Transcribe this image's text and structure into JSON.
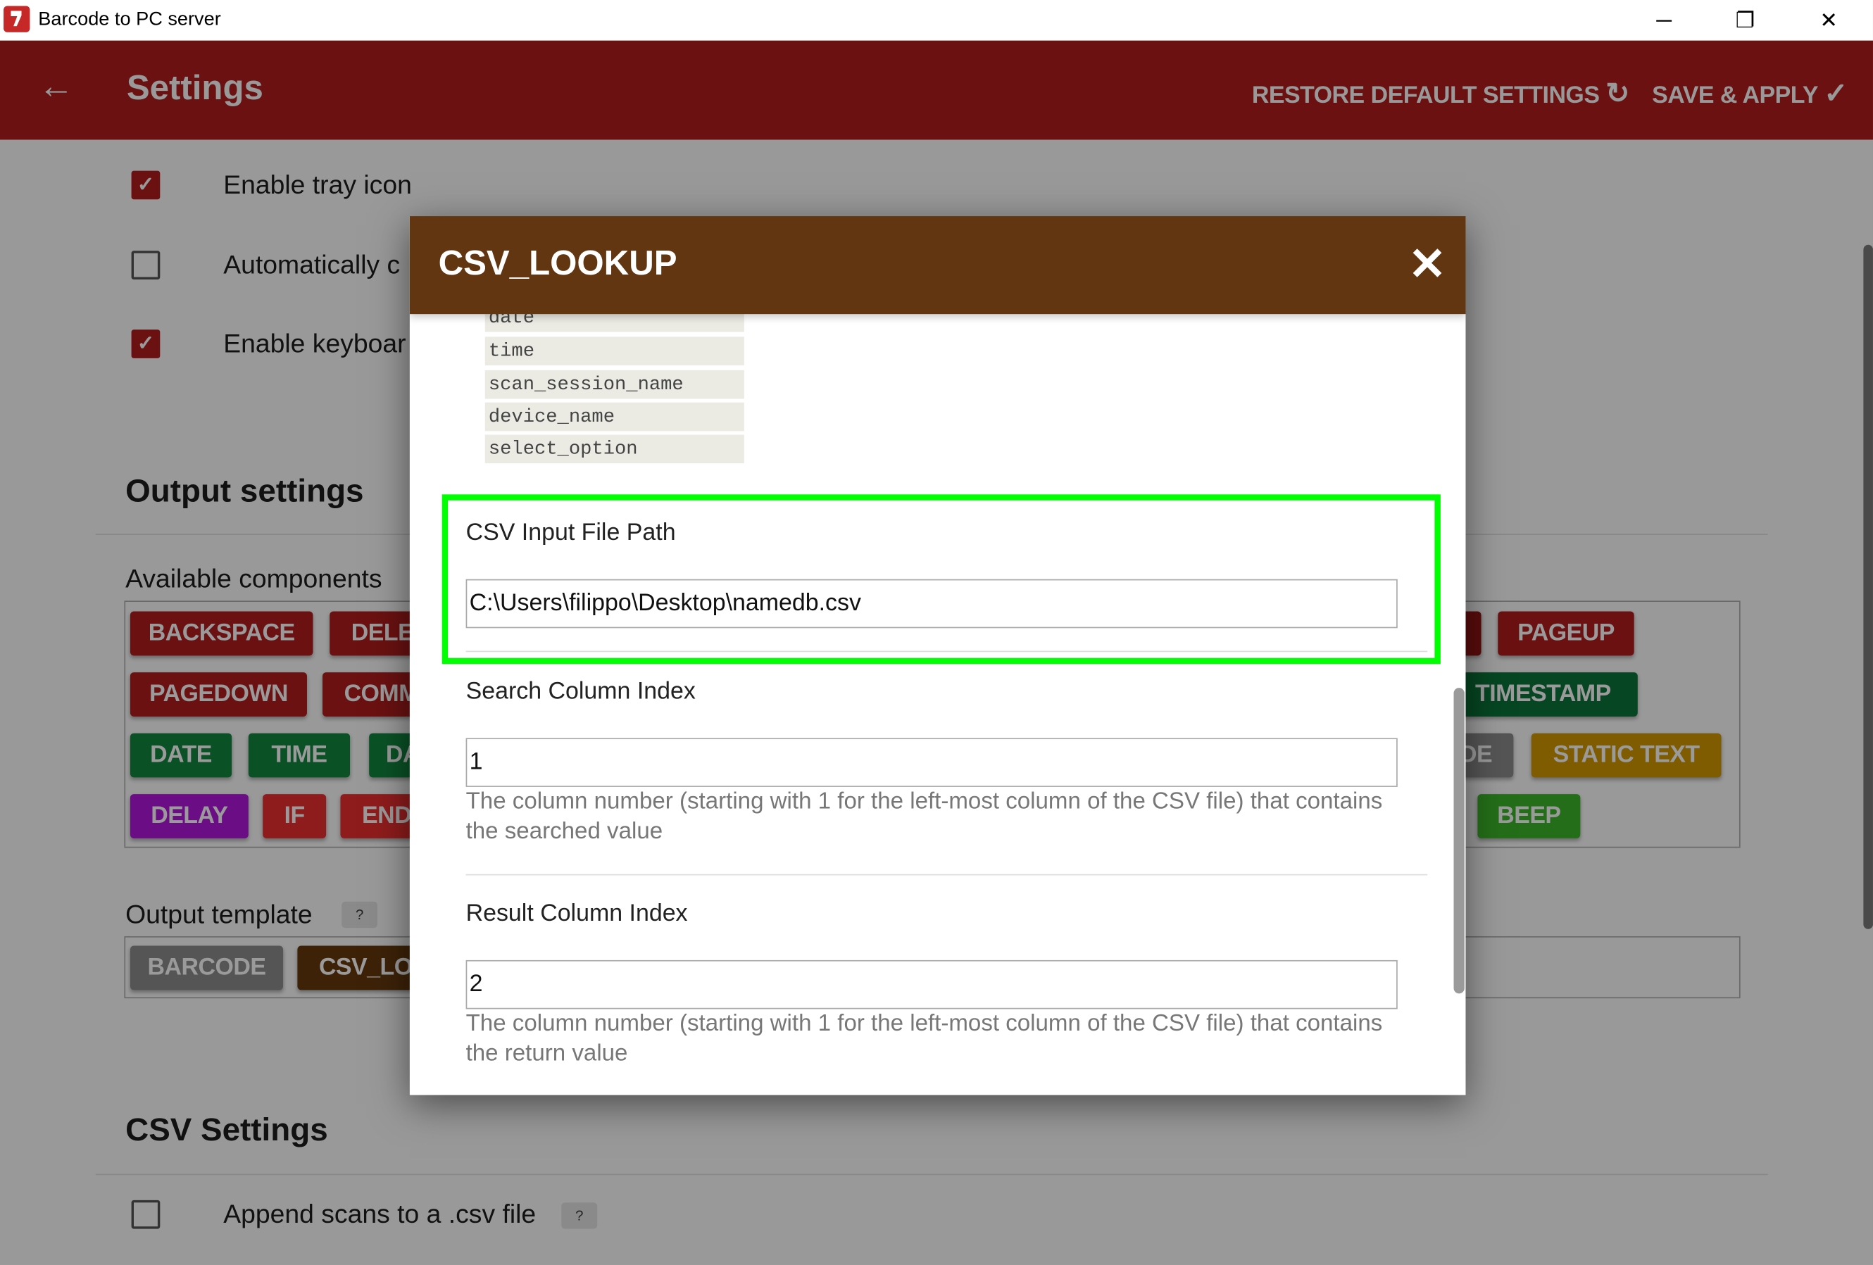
{
  "window": {
    "title": "Barcode to PC server",
    "controls": {
      "minimize": "─",
      "restore": "❐",
      "close": "✕"
    }
  },
  "header": {
    "title": "Settings",
    "back_icon": "←",
    "restore_label": "RESTORE DEFAULT SETTINGS",
    "restore_icon": "↻",
    "save_label": "SAVE & APPLY",
    "save_icon": "✓"
  },
  "general": [
    {
      "label": "Enable tray icon",
      "checked": true
    },
    {
      "label": "Automatically c",
      "checked": false
    },
    {
      "label": "Enable keyboar",
      "checked": true
    }
  ],
  "output": {
    "title": "Output settings",
    "available_label": "Available components",
    "chips": [
      {
        "label": "BACKSPACE",
        "color": "#6b1111"
      },
      {
        "label": "DELE",
        "color": "#6b1111"
      },
      {
        "label": "",
        "color": "#5a0c0c"
      },
      {
        "label": "PAGEUP",
        "color": "#6b1111"
      },
      {
        "label": "PAGEDOWN",
        "color": "#6b1111"
      },
      {
        "label": "COMM",
        "color": "#6b1111"
      },
      {
        "label": "TIMESTAMP",
        "color": "#064622"
      },
      {
        "label": "DATE",
        "color": "#0a5226"
      },
      {
        "label": "TIME",
        "color": "#0a5226"
      },
      {
        "label": "DA",
        "color": "#0a5226"
      },
      {
        "label": "DE",
        "color": "#555555"
      },
      {
        "label": "STATIC TEXT",
        "color": "#7f5c00"
      },
      {
        "label": "DELAY",
        "color": "#6b0d84"
      },
      {
        "label": "IF",
        "color": "#8f1c1c"
      },
      {
        "label": "END",
        "color": "#8f1c1c"
      },
      {
        "label": "BEEP",
        "color": "#246e19"
      }
    ],
    "template_label": "Output template",
    "help_badge": "?",
    "template_chips": [
      {
        "label": "BARCODE",
        "color": "#555555"
      },
      {
        "label": "CSV_LO",
        "color": "#3d2208"
      }
    ]
  },
  "csv": {
    "title": "CSV Settings",
    "append_label": "Append scans to a .csv file",
    "append_checked": false,
    "help_badge": "?"
  },
  "modal": {
    "title": "CSV_LOOKUP",
    "close_icon": "✕",
    "variables": [
      "date",
      "time",
      "scan_session_name",
      "device_name",
      "select_option"
    ],
    "fields": [
      {
        "label": "CSV Input File Path",
        "value": "C:\\Users\\filippo\\Desktop\\namedb.csv"
      },
      {
        "label": "Search Column Index",
        "value": "1",
        "help": "The column number (starting with 1 for the left-most column of the CSV file) that contains the searched value"
      },
      {
        "label": "Result Column Index",
        "value": "2",
        "help": "The column number (starting with 1 for the left-most column of the CSV file) that contains the return value"
      }
    ],
    "highlight_color": "#00ff00"
  }
}
